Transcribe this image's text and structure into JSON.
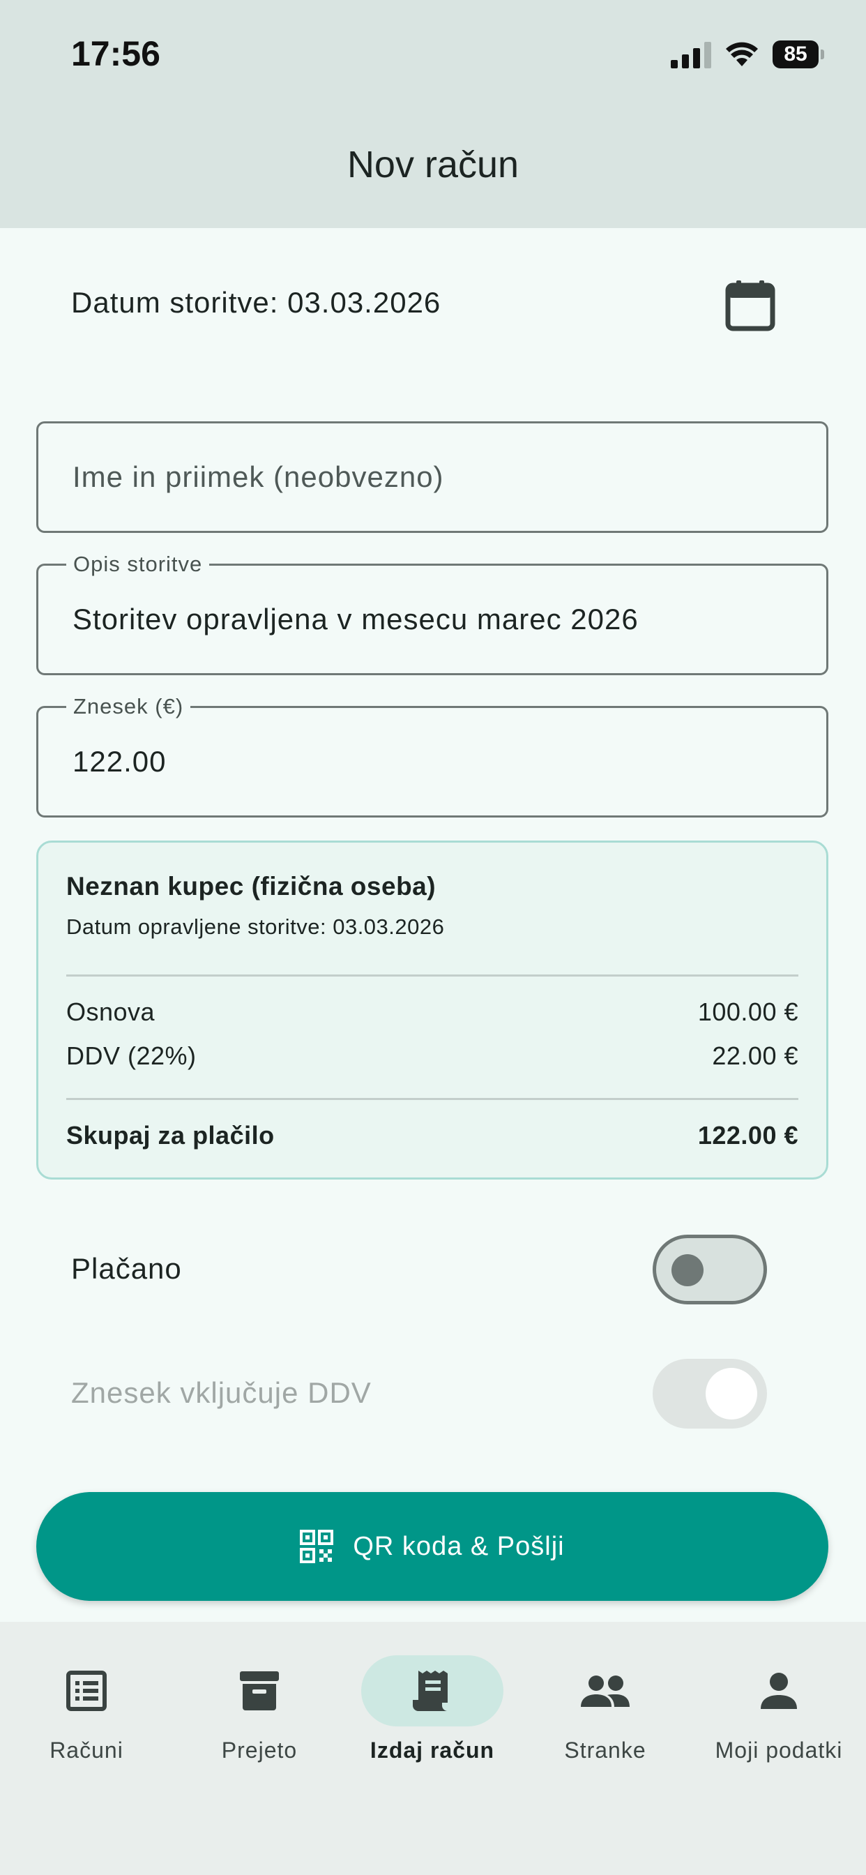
{
  "status_bar": {
    "time": "17:56",
    "battery": "85"
  },
  "header": {
    "title": "Nov račun"
  },
  "form": {
    "service_date_label": "Datum storitve: 03.03.2026",
    "name_placeholder": "Ime in priimek (neobvezno)",
    "description_label": "Opis storitve",
    "description_value": "Storitev opravljena v mesecu marec 2026",
    "amount_label": "Znesek (€)",
    "amount_value": "122.00"
  },
  "summary": {
    "buyer": "Neznan kupec (fizična oseba)",
    "service_date": "Datum opravljene storitve: 03.03.2026",
    "base_label": "Osnova",
    "base_value": "100.00 €",
    "vat_label": "DDV (22%)",
    "vat_value": "22.00 €",
    "total_label": "Skupaj za plačilo",
    "total_value": "122.00 €"
  },
  "toggles": {
    "paid_label": "Plačano",
    "paid_on": false,
    "vat_included_label": "Znesek vključuje DDV",
    "vat_included_on": true
  },
  "actions": {
    "qr_send_label": "QR koda & Pošlji"
  },
  "bottom_nav": {
    "items": [
      {
        "label": "Računi",
        "icon": "list-alt-icon"
      },
      {
        "label": "Prejeto",
        "icon": "archive-icon"
      },
      {
        "label": "Izdaj račun",
        "icon": "receipt-icon",
        "active": true
      },
      {
        "label": "Stranke",
        "icon": "people-icon"
      },
      {
        "label": "Moji podatki",
        "icon": "person-icon"
      }
    ]
  },
  "colors": {
    "primary": "#009688",
    "appbar": "#d9e4e1",
    "background": "#f3faf8",
    "summary_bg": "#eaf6f2",
    "summary_border": "#a9dcd4",
    "nav_active": "#cde8e2"
  }
}
